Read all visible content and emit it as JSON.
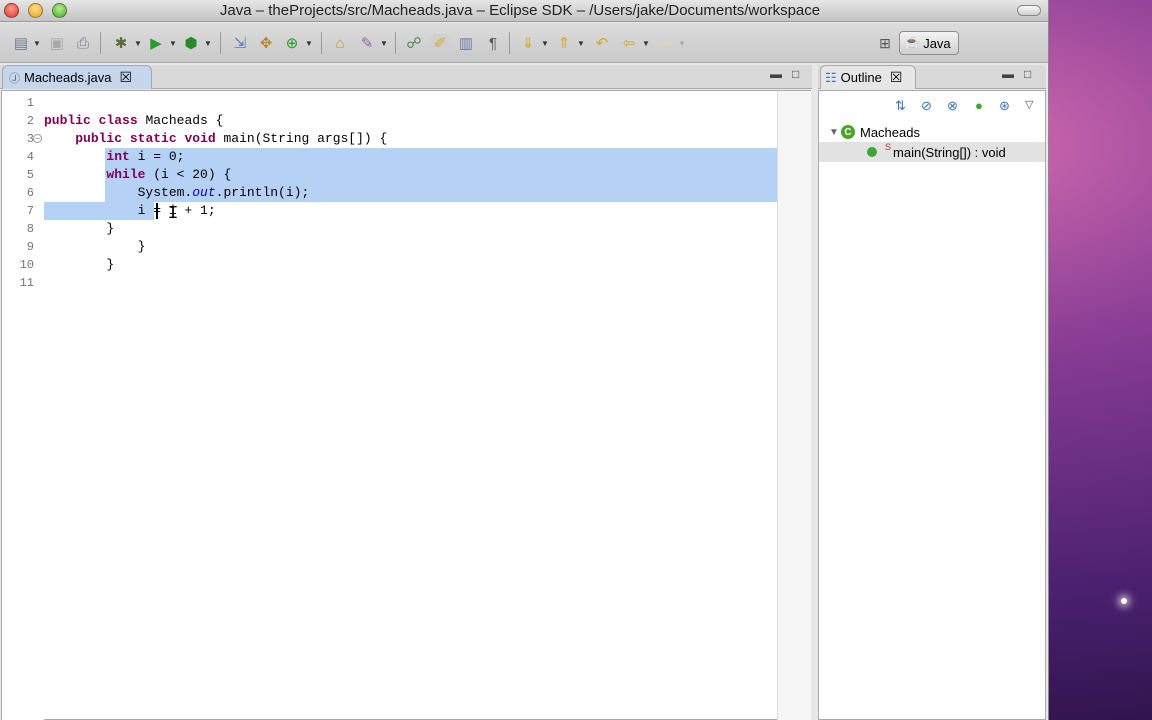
{
  "window": {
    "title": "Java – theProjects/src/Macheads.java – Eclipse SDK – /Users/jake/Documents/workspace"
  },
  "toolbar": {
    "perspective_label": "Java",
    "icons": [
      "new-wizard-icon",
      "save-icon",
      "print-icon",
      "debug-icon",
      "run-icon",
      "external-tools-icon",
      "new-java-project-icon",
      "new-package-icon",
      "new-class-icon",
      "open-type-icon",
      "search-icon",
      "toggle-breadcrumb-icon",
      "mark-occurrences-icon",
      "block-selection-icon",
      "show-whitespace-icon",
      "next-annotation-icon",
      "previous-annotation-icon",
      "last-edit-location-icon",
      "back-icon",
      "forward-icon"
    ]
  },
  "editor": {
    "tab_label": "Macheads.java",
    "lines": [
      {
        "n": "1",
        "segments": []
      },
      {
        "n": "2",
        "segments": [
          {
            "t": "public",
            "k": "kw"
          },
          {
            "t": " "
          },
          {
            "t": "class",
            "k": "kw"
          },
          {
            "t": " Macheads {"
          }
        ]
      },
      {
        "n": "3",
        "segments": [
          {
            "t": "    "
          },
          {
            "t": "public",
            "k": "kw"
          },
          {
            "t": " "
          },
          {
            "t": "static",
            "k": "kw"
          },
          {
            "t": " "
          },
          {
            "t": "void",
            "k": "kw"
          },
          {
            "t": " main(String args[]) {"
          }
        ]
      },
      {
        "n": "4",
        "segments": [
          {
            "t": "        "
          },
          {
            "t": "int",
            "k": "kw"
          },
          {
            "t": " i = 0;"
          }
        ]
      },
      {
        "n": "5",
        "segments": [
          {
            "t": "        "
          },
          {
            "t": "while",
            "k": "kw"
          },
          {
            "t": " (i < 20) {"
          }
        ]
      },
      {
        "n": "6",
        "segments": [
          {
            "t": "            System."
          },
          {
            "t": "out",
            "k": "fld"
          },
          {
            "t": ".println(i);"
          }
        ]
      },
      {
        "n": "7",
        "segments": [
          {
            "t": "            i = i + 1;"
          }
        ]
      },
      {
        "n": "8",
        "segments": [
          {
            "t": "        }"
          }
        ]
      },
      {
        "n": "9",
        "segments": [
          {
            "t": "            }"
          }
        ]
      },
      {
        "n": "10",
        "segments": [
          {
            "t": "        }"
          }
        ]
      },
      {
        "n": "11",
        "segments": []
      }
    ]
  },
  "outline": {
    "tab_label": "Outline",
    "class_name": "Macheads",
    "method_label": "main(String[]) : void",
    "static_marker": "S"
  }
}
